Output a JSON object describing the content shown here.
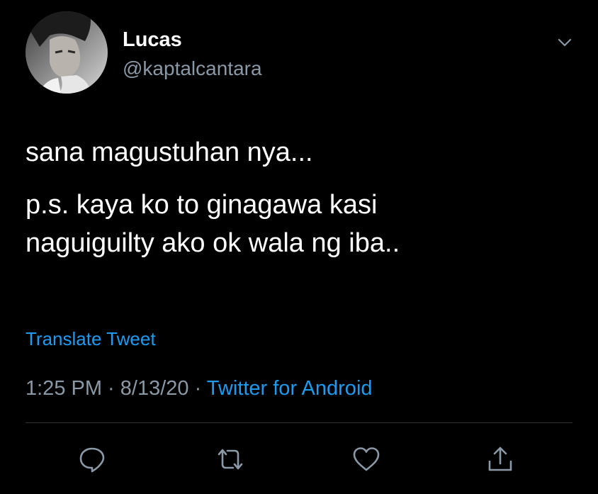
{
  "tweet": {
    "author": {
      "display_name": "Lucas",
      "handle": "@kaptalcantara"
    },
    "text_paragraphs": [
      "sana magustuhan nya...",
      "p.s. kaya ko to ginagawa kasi\nnaguiguilty ako ok wala ng iba.."
    ],
    "translate_label": "Translate Tweet",
    "time": "1:25 PM",
    "separator": " · ",
    "date": "8/13/20",
    "source": "Twitter for Android"
  },
  "icons": {
    "more": "chevron-down-icon",
    "reply": "reply-icon",
    "retweet": "retweet-icon",
    "like": "heart-icon",
    "share": "share-icon"
  },
  "colors": {
    "background": "#000000",
    "text_primary": "#ffffff",
    "text_secondary": "#8b98a5",
    "accent": "#1d9bf0",
    "divider": "#2f3336"
  }
}
